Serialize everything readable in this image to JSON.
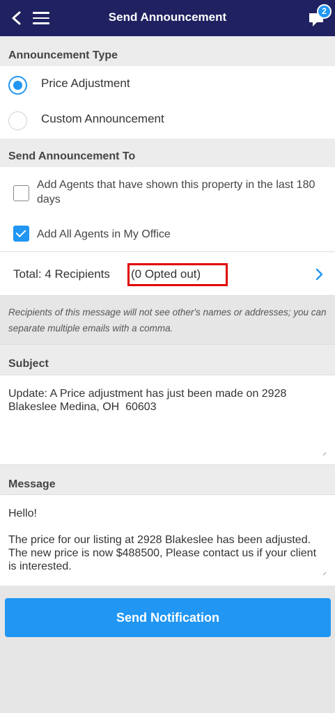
{
  "header": {
    "title": "Send Announcement",
    "notification_count": "2"
  },
  "announcement_type": {
    "heading": "Announcement Type",
    "options": [
      {
        "label": "Price Adjustment",
        "selected": true
      },
      {
        "label": "Custom Announcement",
        "selected": false
      }
    ]
  },
  "send_to": {
    "heading": "Send Announcement To",
    "options": [
      {
        "label": "Add Agents that have shown this property in the last 180 days",
        "checked": false
      },
      {
        "label": "Add All Agents in My Office",
        "checked": true
      }
    ]
  },
  "recipients": {
    "total_label": "Total: 4 Recipients",
    "opted_out_label": "(0 Opted out)"
  },
  "privacy_note": "Recipients of this message will not see other's names or addresses; you can separate multiple emails with a comma.",
  "subject": {
    "heading": "Subject",
    "value": "Update: A Price adjustment has just been made on 2928 Blakeslee Medina, OH  60603"
  },
  "message": {
    "heading": "Message",
    "value": "Hello!\n\nThe price for our listing at 2928 Blakeslee has been adjusted. The new price is now $488500, Please contact us if your client is interested."
  },
  "send_button_label": "Send Notification",
  "colors": {
    "header_bg": "#1f2160",
    "accent": "#2196f3",
    "highlight_box": "#e00000"
  }
}
